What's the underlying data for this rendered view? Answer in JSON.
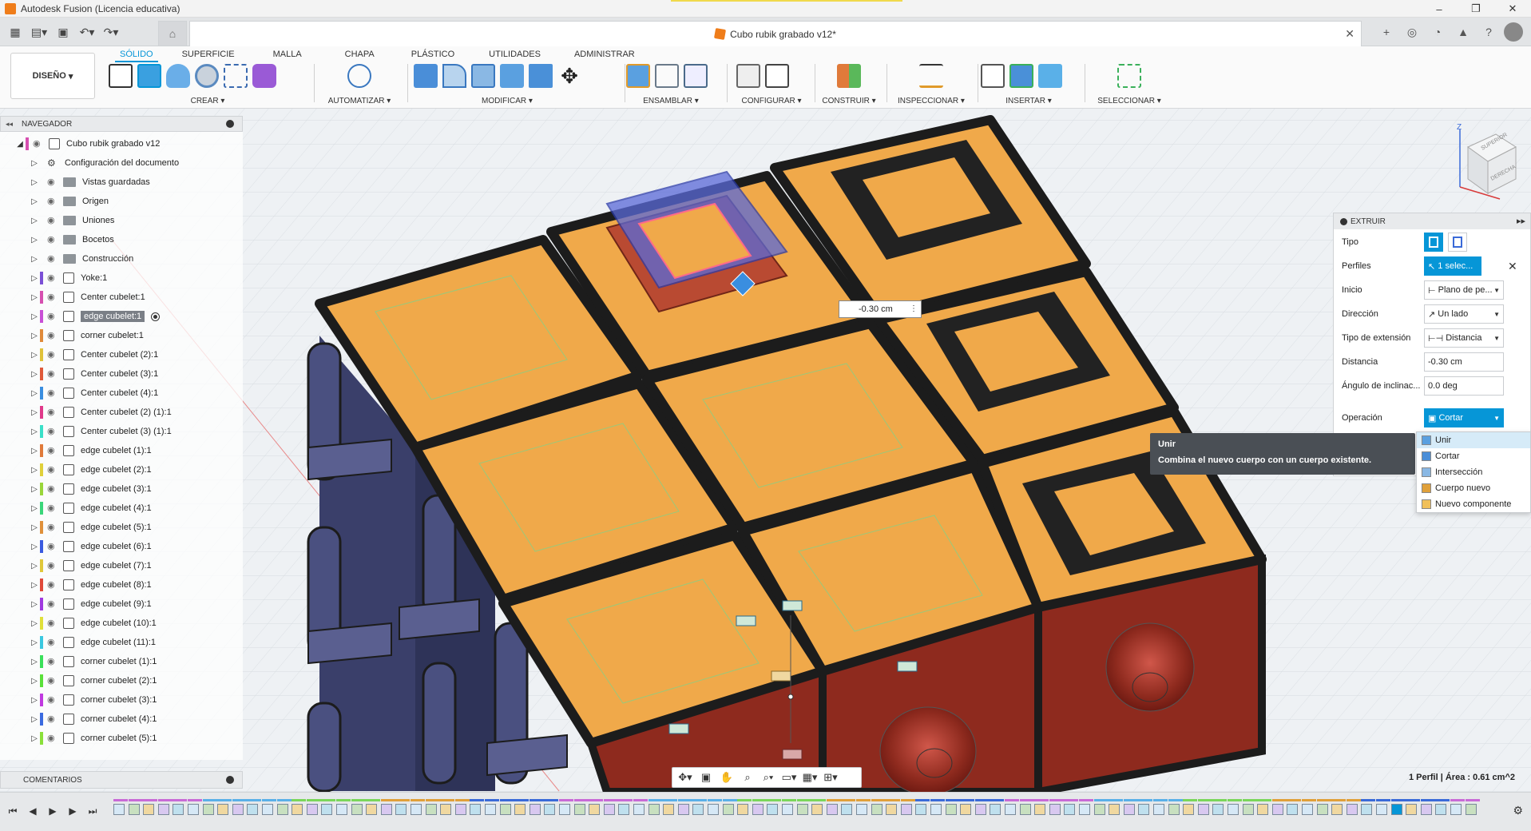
{
  "window": {
    "title": "Autodesk Fusion (Licencia educativa)",
    "controls": [
      "–",
      "❐",
      "✕"
    ]
  },
  "document": {
    "tab_label": "Cubo rubik grabado v12*",
    "close": "✕"
  },
  "ribbon": {
    "design_button": "DISEÑO",
    "tabs": [
      "SÓLIDO",
      "SUPERFICIE",
      "MALLA",
      "CHAPA",
      "PLÁSTICO",
      "UTILIDADES",
      "ADMINISTRAR"
    ],
    "active_tab": "SÓLIDO",
    "groups": [
      "CREAR ▾",
      "AUTOMATIZAR ▾",
      "MODIFICAR ▾",
      "ENSAMBLAR ▾",
      "CONFIGURAR ▾",
      "CONSTRUIR ▾",
      "INSPECCIONAR ▾",
      "INSERTAR ▾",
      "SELECCIONAR ▾"
    ]
  },
  "navigator": {
    "title": "NAVEGADOR",
    "root": "Cubo rubik grabado v12",
    "items": [
      {
        "label": "Configuración del documento",
        "type": "gear",
        "color": ""
      },
      {
        "label": "Vistas guardadas",
        "type": "folder",
        "color": ""
      },
      {
        "label": "Origen",
        "type": "folder",
        "color": ""
      },
      {
        "label": "Uniones",
        "type": "folder",
        "color": ""
      },
      {
        "label": "Bocetos",
        "type": "folder",
        "color": ""
      },
      {
        "label": "Construcción",
        "type": "folder",
        "color": ""
      },
      {
        "label": "Yoke:1",
        "type": "comp",
        "color": "#7b4fd6"
      },
      {
        "label": "Center cubelet:1",
        "type": "comp",
        "color": "#d64fb0"
      },
      {
        "label": "edge cubelet:1",
        "type": "comp",
        "color": "#c94fd6",
        "selected": true
      },
      {
        "label": "corner cubelet:1",
        "type": "comp",
        "color": "#e08a3a"
      },
      {
        "label": "Center cubelet (2):1",
        "type": "comp",
        "color": "#e0c23a"
      },
      {
        "label": "Center cubelet (3):1",
        "type": "comp",
        "color": "#e05a3a"
      },
      {
        "label": "Center cubelet (4):1",
        "type": "comp",
        "color": "#3a8ee0"
      },
      {
        "label": "Center cubelet (2) (1):1",
        "type": "comp",
        "color": "#e03a8a"
      },
      {
        "label": "Center cubelet (3) (1):1",
        "type": "comp",
        "color": "#3ae0c8"
      },
      {
        "label": "edge cubelet (1):1",
        "type": "comp",
        "color": "#e07a3a"
      },
      {
        "label": "edge cubelet (2):1",
        "type": "comp",
        "color": "#e0d03a"
      },
      {
        "label": "edge cubelet (3):1",
        "type": "comp",
        "color": "#9ad63a"
      },
      {
        "label": "edge cubelet (4):1",
        "type": "comp",
        "color": "#3ad67a"
      },
      {
        "label": "edge cubelet (5):1",
        "type": "comp",
        "color": "#e0903a"
      },
      {
        "label": "edge cubelet (6):1",
        "type": "comp",
        "color": "#3a5ae0"
      },
      {
        "label": "edge cubelet (7):1",
        "type": "comp",
        "color": "#e0c83a"
      },
      {
        "label": "edge cubelet (8):1",
        "type": "comp",
        "color": "#e04a3a"
      },
      {
        "label": "edge cubelet (9):1",
        "type": "comp",
        "color": "#a03ae0"
      },
      {
        "label": "edge cubelet (10):1",
        "type": "comp",
        "color": "#e0e03a"
      },
      {
        "label": "edge cubelet (11):1",
        "type": "comp",
        "color": "#3ac8e0"
      },
      {
        "label": "corner cubelet (1):1",
        "type": "comp",
        "color": "#3ae05a"
      },
      {
        "label": "corner cubelet (2):1",
        "type": "comp",
        "color": "#5ae03a"
      },
      {
        "label": "corner cubelet (3):1",
        "type": "comp",
        "color": "#c03ae0"
      },
      {
        "label": "corner cubelet (4):1",
        "type": "comp",
        "color": "#3a6ae0"
      },
      {
        "label": "corner cubelet (5):1",
        "type": "comp",
        "color": "#8ae03a"
      }
    ]
  },
  "comments": {
    "title": "COMENTARIOS"
  },
  "extrude": {
    "title": "EXTRUIR",
    "fields": [
      {
        "label": "Tipo",
        "value": ""
      },
      {
        "label": "Perfiles",
        "value": "1 selec..."
      },
      {
        "label": "Inicio",
        "value": "Plano de pe..."
      },
      {
        "label": "Dirección",
        "value": "Un lado"
      },
      {
        "label": "Tipo de extensión",
        "value": "Distancia"
      },
      {
        "label": "Distancia",
        "value": "-0.30 cm"
      },
      {
        "label": "Ángulo de inclinac...",
        "value": "0.0 deg"
      },
      {
        "label": "Operación",
        "value": "Cortar"
      }
    ],
    "operation_options": [
      "Unir",
      "Cortar",
      "Intersección",
      "Cuerpo nuevo",
      "Nuevo componente"
    ],
    "highlighted_option": "Unir"
  },
  "tooltip": {
    "title": "Unir",
    "body": "Combina el nuevo cuerpo con un cuerpo existente."
  },
  "dimension_input": "-0.30 cm",
  "status": {
    "profile_info": "1 Perfil | Área : 0.61 cm^2"
  },
  "viewcube": {
    "face_top": "SUPERIOR",
    "face_right": "DERECHA",
    "axis_z": "Z"
  },
  "colors": {
    "accent": "#0696d7",
    "face_orange": "#f0a94a",
    "face_red": "#8e2a1e",
    "frame": "#1c1c1c"
  }
}
